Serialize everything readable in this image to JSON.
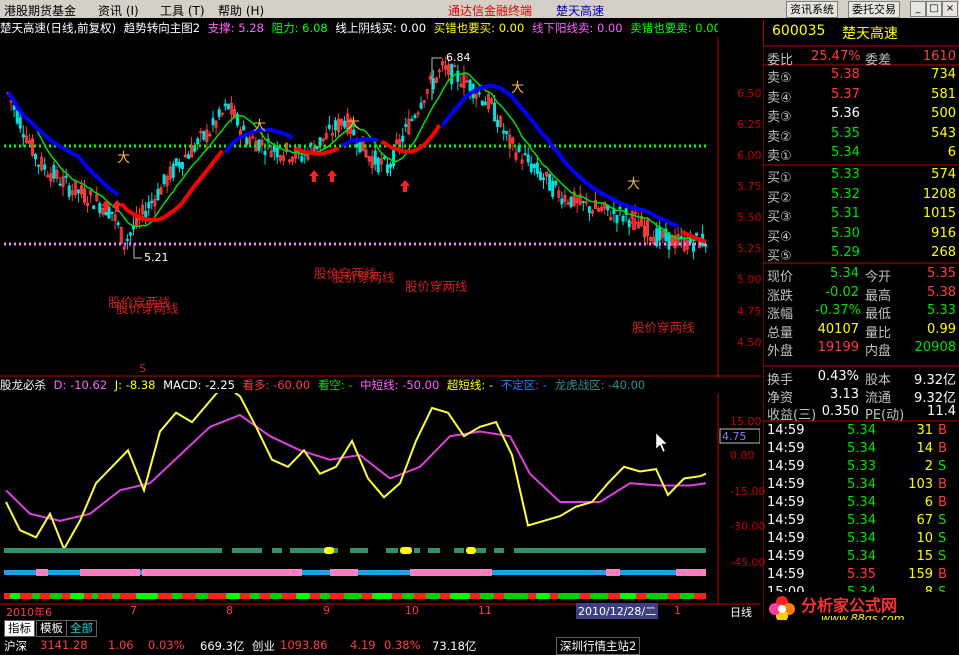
{
  "menu": {
    "items": [
      "港股期货基金",
      "资讯 (I)",
      "工具 (T)",
      "帮助 (H)"
    ],
    "center_title": "通达信金融终端",
    "stock_title": "楚天高速",
    "info_btn": "资讯系统",
    "trade_btn": "委托交易"
  },
  "chart_title": {
    "name": "楚天高速(日线,前复权)",
    "indicator": "趋势转向主图2",
    "support_label": "支撑: 5.28",
    "resistance_label": "阻力: 6.08",
    "line_label": "线上阴线买: 0.00",
    "buy1_label": "买错也要买: 0.00",
    "sell1_label": "线下阳线卖: 0.00",
    "sell2_label": "卖错也要卖: 0.00"
  },
  "price_axis": [
    "6.50",
    "6.25",
    "6.00",
    "5.75",
    "5.50",
    "5.25",
    "5.00",
    "4.75",
    "4.50"
  ],
  "annotations": {
    "high": "6.84",
    "low": "5.21",
    "cross1": "股价穿两线",
    "cross2": "股价穿两线",
    "cross3": "股价穿两线",
    "cross4": "股价穿两线",
    "cross5": "股价穿两线",
    "s_mark": "S"
  },
  "indicator_title": {
    "name": "股龙必杀",
    "d": "D: -10.62",
    "j": "J: -8.38",
    "macd": "MACD: -2.25",
    "bull": "看多: -60.00",
    "bear": "看空: -",
    "mid": "中短线: -50.00",
    "super": "超短线: -",
    "unsure": "不定区: -",
    "dragon": "龙虎战区: -40.00"
  },
  "indicator_axis": [
    "15.00",
    "0.00",
    "-15.00",
    "-30.00",
    "-45.00"
  ],
  "indicator_value_box": "4.75",
  "date_axis": {
    "labels": [
      "2010年6",
      "7",
      "8",
      "9",
      "10",
      "11",
      "1"
    ],
    "cursor_date": "2010/12/28/二",
    "period": "日线"
  },
  "quote": {
    "code": "600035",
    "name": "楚天高速",
    "webi_label": "委比",
    "webi_value": "25.47%",
    "weicha_label": "委差",
    "weicha_value": "1610",
    "asks": [
      {
        "label": "卖⑤",
        "price": "5.38",
        "vol": "734"
      },
      {
        "label": "卖④",
        "price": "5.37",
        "vol": "581"
      },
      {
        "label": "卖③",
        "price": "5.36",
        "vol": "500"
      },
      {
        "label": "卖②",
        "price": "5.35",
        "vol": "543"
      },
      {
        "label": "卖①",
        "price": "5.34",
        "vol": "6"
      }
    ],
    "bids": [
      {
        "label": "买①",
        "price": "5.33",
        "vol": "574"
      },
      {
        "label": "买②",
        "price": "5.32",
        "vol": "1208"
      },
      {
        "label": "买③",
        "price": "5.31",
        "vol": "1015"
      },
      {
        "label": "买④",
        "price": "5.30",
        "vol": "916"
      },
      {
        "label": "买⑤",
        "price": "5.29",
        "vol": "268"
      }
    ],
    "stats": [
      {
        "l1": "现价",
        "v1": "5.34",
        "l2": "今开",
        "v2": "5.35"
      },
      {
        "l1": "涨跌",
        "v1": "-0.02",
        "l2": "最高",
        "v2": "5.38"
      },
      {
        "l1": "涨幅",
        "v1": "-0.37%",
        "l2": "最低",
        "v2": "5.33"
      },
      {
        "l1": "总量",
        "v1": "40107",
        "l2": "量比",
        "v2": "0.99"
      },
      {
        "l1": "外盘",
        "v1": "19199",
        "l2": "内盘",
        "v2": "20908"
      }
    ],
    "stats2": [
      {
        "l1": "换手",
        "v1": "0.43%",
        "l2": "股本",
        "v2": "9.32亿"
      },
      {
        "l1": "净资",
        "v1": "3.13",
        "l2": "流通",
        "v2": "9.32亿"
      },
      {
        "l1": "收益(三)",
        "v1": "0.350",
        "l2": "PE(动)",
        "v2": "11.4"
      }
    ],
    "ticks": [
      {
        "t": "14:59",
        "p": "5.34",
        "v": "31",
        "f": "B"
      },
      {
        "t": "14:59",
        "p": "5.34",
        "v": "14",
        "f": "B"
      },
      {
        "t": "14:59",
        "p": "5.33",
        "v": "2",
        "f": "S"
      },
      {
        "t": "14:59",
        "p": "5.34",
        "v": "103",
        "f": "B"
      },
      {
        "t": "14:59",
        "p": "5.34",
        "v": "6",
        "f": "B"
      },
      {
        "t": "14:59",
        "p": "5.34",
        "v": "67",
        "f": "S"
      },
      {
        "t": "14:59",
        "p": "5.34",
        "v": "10",
        "f": "S"
      },
      {
        "t": "14:59",
        "p": "5.34",
        "v": "15",
        "f": "S"
      },
      {
        "t": "14:59",
        "p": "5.35",
        "v": "159",
        "f": "B"
      },
      {
        "t": "15:00",
        "p": "5.34",
        "v": "8",
        "f": "S"
      }
    ]
  },
  "bottom_tabs": [
    "指标",
    "模板",
    "全部"
  ],
  "ticker": {
    "sh_label": "沪深",
    "sh_value": "3141.28",
    "sh_chg": "1.06",
    "sh_pct": "0.03%",
    "sh_amt": "669.3亿",
    "cy_label": "创业",
    "cy_value": "1093.86",
    "cy_chg": "4.19",
    "cy_pct": "0.38%",
    "cy_amt": "73.18亿",
    "news": "深圳行情主站2"
  },
  "watermark": {
    "brand": "分析家公式网",
    "url": "www.88gs.com"
  },
  "colors": {
    "up": "#ff3c3c",
    "down": "#00e000",
    "ma_red": "#ff0000",
    "ma_green": "#00ff00",
    "ma_blue": "#0000ff",
    "candle_up": "#ff3c3c",
    "candle_down": "#00e0e0"
  }
}
